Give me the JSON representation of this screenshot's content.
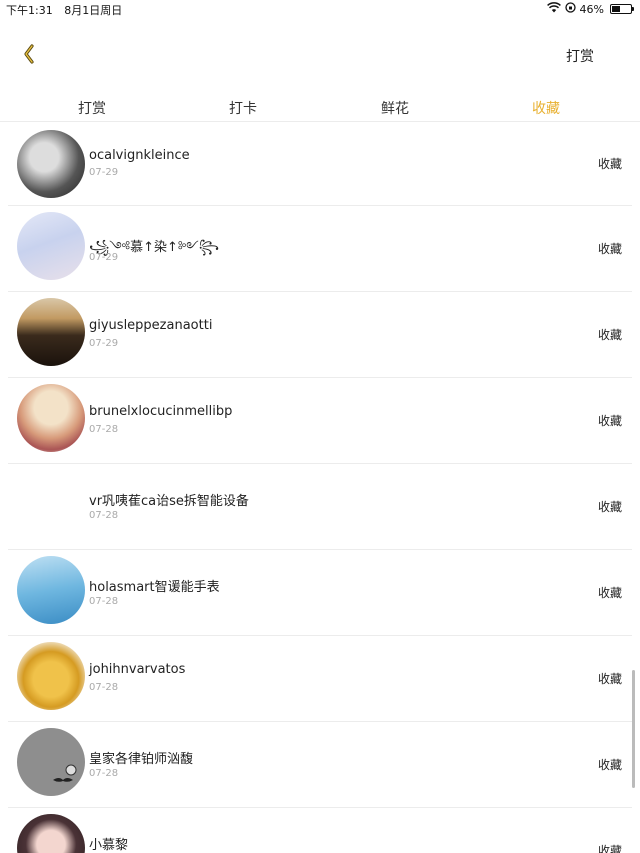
{
  "status_bar": {
    "time": "下午1:31",
    "date": "8月1日周日",
    "battery_percent": "46%",
    "battery_level": 0.46
  },
  "nav": {
    "action_label": "打赏"
  },
  "tabs": [
    {
      "label": "打赏",
      "active": false
    },
    {
      "label": "打卡",
      "active": false
    },
    {
      "label": "鲜花",
      "active": false
    },
    {
      "label": "收藏",
      "active": true
    }
  ],
  "colors": {
    "accent": "#e8b030",
    "divider": "#ececec",
    "secondary_text": "#aaaaaa"
  },
  "items": [
    {
      "name": "ocalvignkleince",
      "date": "07-29",
      "action": "收藏"
    },
    {
      "name": "꧁༺慕↑染↑༻꧂",
      "date": "07-29",
      "action": "收藏"
    },
    {
      "name": "giyusleppezanaotti",
      "date": "07-29",
      "action": "收藏"
    },
    {
      "name": "brunelxlocucinmellibp",
      "date": "07-28",
      "action": "收藏"
    },
    {
      "name": "vr巩咦萑ca诒se拆智能设备",
      "date": "07-28",
      "action": "收藏"
    },
    {
      "name": "holasmart智谖能手表",
      "date": "07-28",
      "action": "收藏"
    },
    {
      "name": "johihnvarvatos",
      "date": "07-28",
      "action": "收藏"
    },
    {
      "name": "皇家各律铂师汹馥",
      "date": "07-28",
      "action": "收藏"
    },
    {
      "name": "小慕黎",
      "date": "",
      "action": "收藏"
    }
  ]
}
